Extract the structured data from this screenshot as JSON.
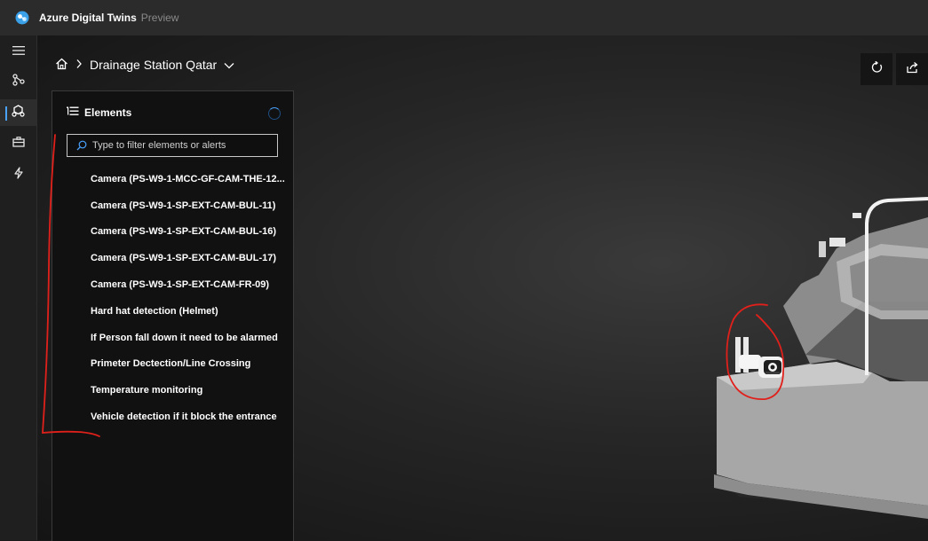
{
  "app": {
    "title": "Azure Digital Twins",
    "badge": "Preview"
  },
  "breadcrumb": {
    "current": "Drainage Station Qatar"
  },
  "panel": {
    "title": "Elements",
    "filter_placeholder": "Type to filter elements or alerts",
    "items": [
      "Camera (PS-W9-1-MCC-GF-CAM-THE-12...",
      "Camera (PS-W9-1-SP-EXT-CAM-BUL-11)",
      "Camera (PS-W9-1-SP-EXT-CAM-BUL-16)",
      "Camera (PS-W9-1-SP-EXT-CAM-BUL-17)",
      "Camera (PS-W9-1-SP-EXT-CAM-FR-09)",
      "Hard hat detection (Helmet)",
      "If Person fall down it need to be alarmed",
      "Primeter Dectection/Line Crossing",
      "Temperature monitoring",
      "Vehicle detection if it block the entrance"
    ]
  },
  "icons": {
    "rail": [
      "hamburger-icon",
      "graph-icon",
      "scene-icon",
      "toolbox-icon",
      "lightning-icon"
    ],
    "toolbar": [
      "refresh-icon",
      "share-icon"
    ]
  },
  "colors": {
    "accent": "#4aa3ff",
    "annotation": "#e0201b"
  }
}
